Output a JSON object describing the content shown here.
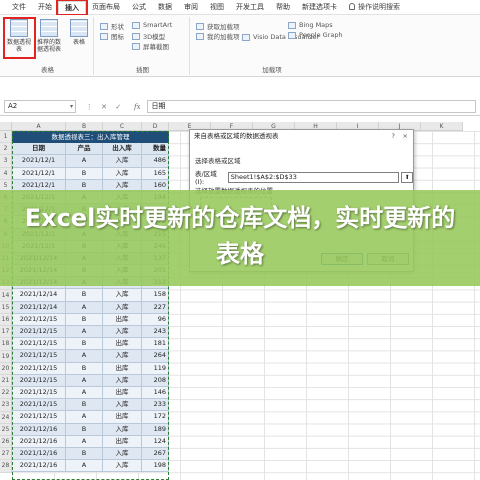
{
  "ribbon": {
    "tabs": [
      "文件",
      "开始",
      "插入",
      "页面布局",
      "公式",
      "数据",
      "审阅",
      "视图",
      "开发工具",
      "帮助",
      "新建选项卡"
    ],
    "active_tab": "插入",
    "tell_me": "操作说明搜索",
    "groups": {
      "tables": {
        "label": "表格",
        "pivot_btn": "数据透视表",
        "rec_pivot_btn": "推荐的数据透视表",
        "table_btn": "表格"
      },
      "illustrations": {
        "label": "插图",
        "items": [
          "形状",
          "图标",
          "SmartArt",
          "3D模型",
          "屏幕截图"
        ]
      },
      "addins": {
        "label": "加载项",
        "items": [
          "获取加载项",
          "我的加载项",
          "Visio Data Visualizer",
          "Bing Maps",
          "People Graph"
        ]
      }
    }
  },
  "formula_bar": {
    "name_box": "A2",
    "fx": "fx",
    "content": "日期"
  },
  "grid": {
    "columns": [
      "A",
      "B",
      "C",
      "D",
      "E",
      "F",
      "G",
      "H",
      "I",
      "J",
      "K"
    ],
    "rows": [
      "1",
      "2",
      "3",
      "4",
      "5",
      "6",
      "7",
      "8",
      "9",
      "10",
      "11",
      "12",
      "13",
      "14",
      "15",
      "16",
      "17",
      "18",
      "19",
      "20",
      "21",
      "22",
      "23",
      "24",
      "25",
      "26",
      "27",
      "28"
    ]
  },
  "table": {
    "title": "数据透视表三：出入库管理",
    "headers": [
      "日期",
      "产品",
      "出入库",
      "数量"
    ],
    "rows": [
      [
        "2021/12/1",
        "A",
        "入库",
        "486"
      ],
      [
        "2021/12/1",
        "B",
        "入库",
        "165"
      ],
      [
        "2021/12/1",
        "B",
        "入库",
        "160"
      ],
      [
        "2021/12/1",
        "A",
        "入库",
        "194"
      ],
      [
        "2021/12/1",
        "B",
        "入库",
        "94"
      ],
      [
        "2021/12/1",
        "B",
        "入库",
        "172"
      ],
      [
        "2021/12/1",
        "A",
        "入库",
        "215"
      ],
      [
        "2021/12/1",
        "B",
        "入库",
        "246"
      ],
      [
        "2021/12/14",
        "A",
        "入库",
        "137"
      ],
      [
        "2021/12/14",
        "B",
        "入库",
        "201"
      ],
      [
        "2021/12/14",
        "A",
        "入库",
        "312"
      ],
      [
        "2021/12/14",
        "B",
        "入库",
        "158"
      ],
      [
        "2021/12/14",
        "A",
        "入库",
        "227"
      ],
      [
        "2021/12/15",
        "B",
        "出库",
        "96"
      ],
      [
        "2021/12/15",
        "A",
        "入库",
        "243"
      ],
      [
        "2021/12/15",
        "B",
        "出库",
        "181"
      ],
      [
        "2021/12/15",
        "A",
        "入库",
        "264"
      ],
      [
        "2021/12/15",
        "B",
        "出库",
        "119"
      ],
      [
        "2021/12/15",
        "A",
        "入库",
        "208"
      ],
      [
        "2021/12/15",
        "A",
        "出库",
        "146"
      ],
      [
        "2021/12/15",
        "B",
        "入库",
        "233"
      ],
      [
        "2021/12/15",
        "A",
        "出库",
        "172"
      ],
      [
        "2021/12/16",
        "B",
        "入库",
        "189"
      ],
      [
        "2021/12/16",
        "A",
        "出库",
        "124"
      ],
      [
        "2021/12/16",
        "B",
        "入库",
        "267"
      ],
      [
        "2021/12/16",
        "A",
        "入库",
        "198"
      ]
    ]
  },
  "dialog": {
    "title": "来自表格或区域的数据透视表",
    "help": "?",
    "close": "×",
    "section1": "选择表格或区域",
    "range_label": "表/区域(I):",
    "range_value": "Sheet1!$A$2:$D$33",
    "section2": "选择放置数据透视表的位置",
    "ok": "确定",
    "cancel": "取消"
  },
  "banner": {
    "text": "Excel实时更新的仓库文档，实时更新的表格"
  }
}
